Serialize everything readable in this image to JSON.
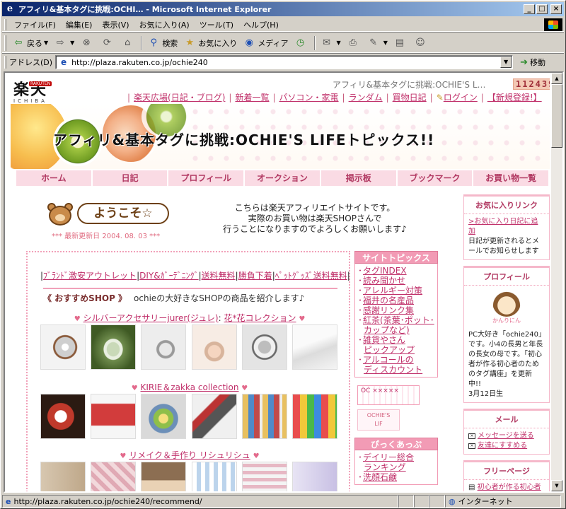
{
  "window": {
    "title": "アフィリ&基本タグに挑戦:OCHI… - Microsoft Internet Explorer"
  },
  "menu": [
    "ファイル(F)",
    "編集(E)",
    "表示(V)",
    "お気に入り(A)",
    "ツール(T)",
    "ヘルプ(H)"
  ],
  "toolbar": {
    "back": "戻る",
    "search": "検索",
    "favorites": "お気に入り",
    "media": "メディア"
  },
  "address": {
    "label": "アドレス(D)",
    "url": "http://plaza.rakuten.co.jp/ochie240",
    "go": "移動"
  },
  "header": {
    "logo_main": "楽天",
    "logo_sub": "ICHIBA",
    "logo_badge": "RAKUTEN",
    "small_title": "アフィリ&基本タグに挑戦:OCHIE'S L…",
    "counter": "112439",
    "top_nav": [
      "楽天広場(日記・ブログ)",
      "新着一覧",
      "パソコン・家電",
      "ランダム",
      "買物日記",
      "ログイン",
      "【新規登録!】"
    ],
    "banner_title": "アフィリ&基本タグに挑戦:OCHIE'S LIFEトピックス!!"
  },
  "nav": [
    "ホーム",
    "日記",
    "プロフィール",
    "オークション",
    "掲示板",
    "ブックマーク",
    "お買い物一覧"
  ],
  "welcome": {
    "bubble": "ようこそ☆",
    "updated": "*** 最新更新日 2004. 08. 03 ***",
    "intro": [
      "こちらは楽天アフィリエイトサイトです。",
      "実際のお買い物は楽天SHOPさんで",
      "行うことになりますのでよろしくお願いします♪"
    ]
  },
  "center": {
    "links": [
      "ﾌﾞﾗﾝﾄﾞ激安アウトレット",
      "DIY&ｶﾞｰﾃﾞﾆﾝｸﾞ",
      "送料無料",
      "勝負下着",
      "ﾍﾟｯﾄｸﾞｯｽﾞ送料無料"
    ],
    "shop_header": "《 おすすめSHOP 》",
    "shop_desc": "ochieの大好きなSHOPの商品を紹介します♪",
    "collection1_a": "シルバーアクセサリーjurer(ジュレ)",
    "collection1_sep": ":",
    "collection1_b": "花*花コレクション",
    "collection2": "KIRIE＆zakka collection",
    "collection3": "リメイク＆手作り リシュリシュ",
    "heart": "♥"
  },
  "topics": {
    "title": "サイトトピックス",
    "items": [
      [
        "タグINDEX"
      ],
      [
        "読み聞かせ"
      ],
      [
        "アレルギー対策"
      ],
      [
        "福井の名産品"
      ],
      [
        "感謝リンク集"
      ],
      [
        "紅茶(茶葉･ポット･",
        "カップなど)"
      ],
      [
        "雑貨やさん",
        "ピックアップ"
      ],
      [
        "アルコールの",
        "ディスカウント"
      ]
    ],
    "stamp1": "OC ××××× ",
    "stamp2_a": "OCHIE'S",
    "stamp2_b": "LIF",
    "pickup_title": "ぴっくあっぷ",
    "pickup_items": [
      [
        "デイリー総合",
        "ランキング"
      ],
      [
        "洗顔石鹸"
      ]
    ]
  },
  "right": {
    "fav_title": "お気に入りリンク",
    "fav_link": ">お気に入り日記に追加",
    "fav_text": "日記が更新されるとメールでお知らせします",
    "profile_title": "プロフィール",
    "profile_avatar_caption": "かんりにん",
    "profile_text": "PC大好き「ochie240」です。小4の長男と年長の長女の母です。「初心者が作る初心者のためのタグ講座」を更新中!!",
    "profile_date": "3月12日生",
    "mail_title": "メール",
    "mail_links": [
      "メッセージを送る",
      "友達にすすめる"
    ],
    "free_title": "フリーページ",
    "free_link": "初心者が作る初心者のためのタグ講座"
  },
  "status": {
    "url": "http://plaza.rakuten.co.jp/ochie240/recommend/",
    "zone": "インターネット"
  }
}
